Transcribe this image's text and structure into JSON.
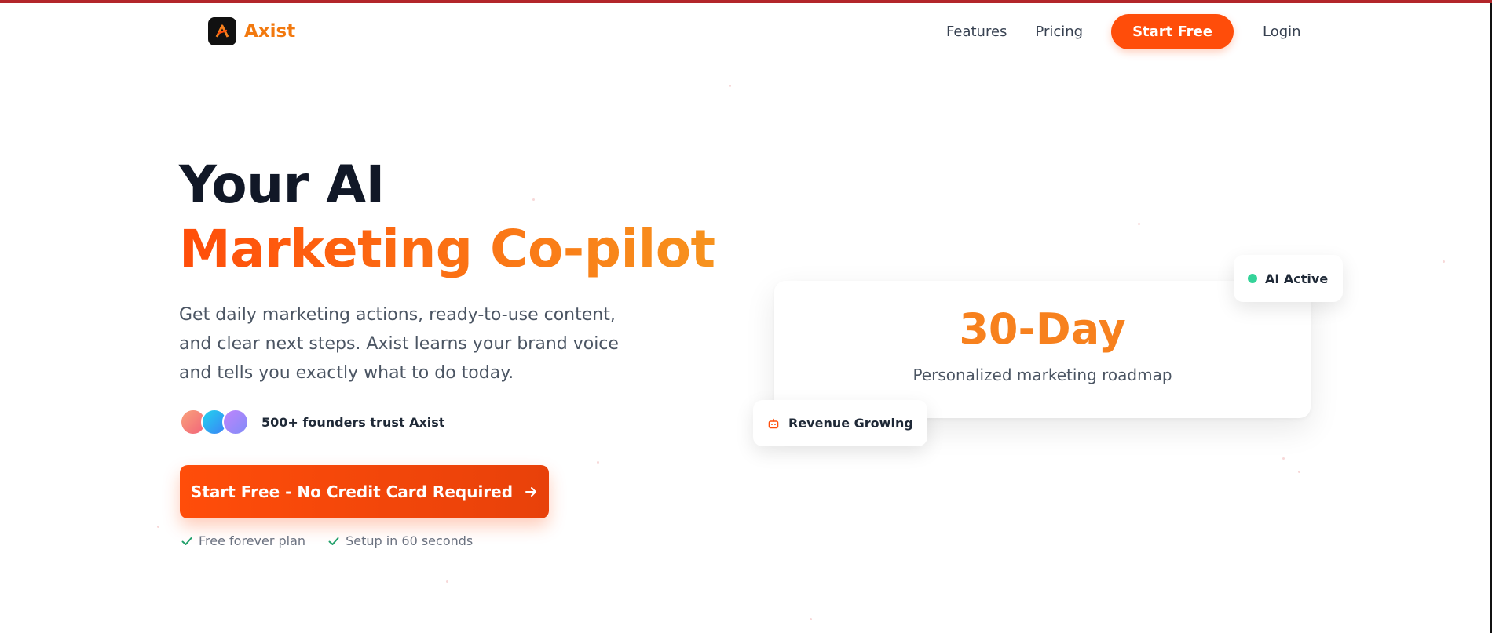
{
  "brand": {
    "name": "Axist",
    "logo_icon": "axist-logo-icon",
    "accent_color": "#ff4d0a",
    "accent_gradient_end": "#f7931e"
  },
  "nav": {
    "features": "Features",
    "pricing": "Pricing",
    "cta": "Start Free",
    "login": "Login"
  },
  "hero": {
    "title_line1": "Your AI",
    "title_line2": "Marketing Co-pilot",
    "subtitle": "Get daily marketing actions, ready-to-use content, and clear next steps. Axist learns your brand voice and tells you exactly what to do today.",
    "trust_text": "500+ founders trust Axist",
    "avatar_colors": [
      "#f2837a",
      "#38bdf8",
      "#a78bfa"
    ],
    "cta_label": "Start Free - No Credit Card Required",
    "cta_icon": "arrow-right-icon",
    "perks": [
      "Free forever plan",
      "Setup in 60 seconds"
    ]
  },
  "stat_card": {
    "value": "30-Day",
    "label": "Personalized marketing roadmap"
  },
  "badges": {
    "ai_status": "AI Active",
    "ai_status_color": "#34d399",
    "revenue": "Revenue Growing",
    "revenue_icon": "robot-icon"
  }
}
